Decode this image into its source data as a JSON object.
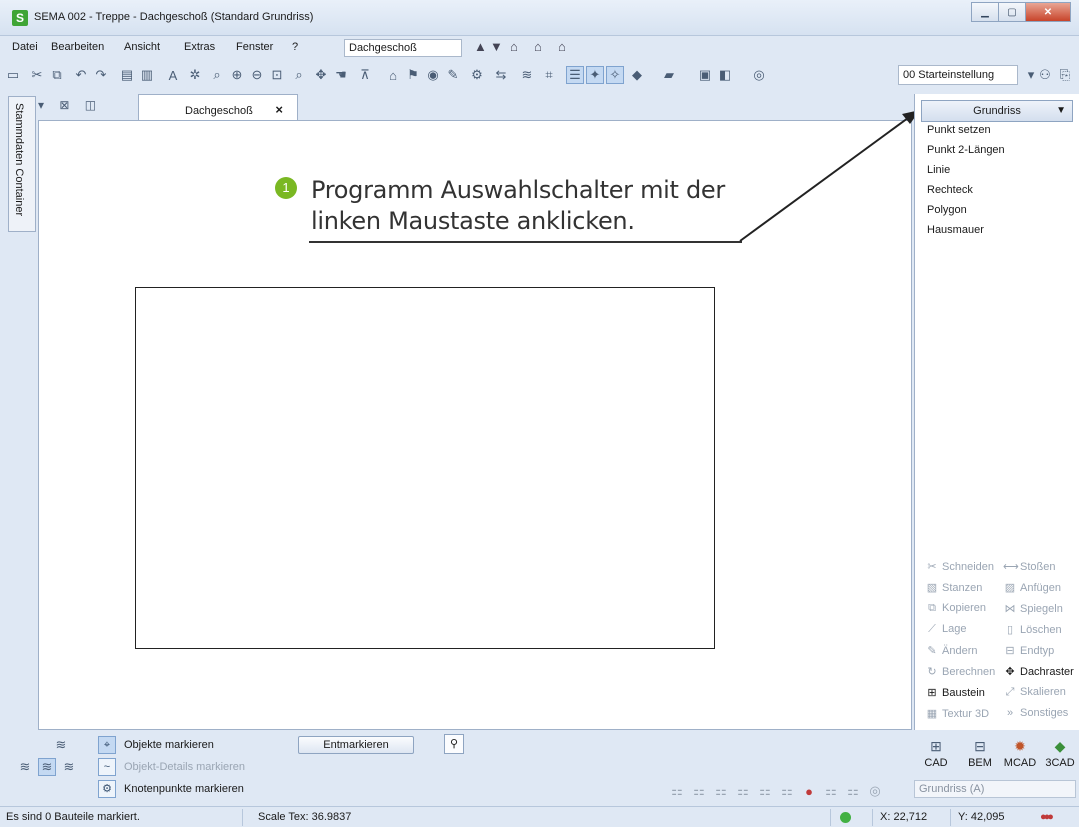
{
  "window": {
    "title": "SEMA  002 - Treppe  - Dachgeschoß (Standard Grundriss)",
    "logo": "S"
  },
  "menu": {
    "items": [
      "Datei",
      "Bearbeiten",
      "Ansicht",
      "Extras",
      "Fenster",
      "?"
    ],
    "floor_select": "Dachgeschoß"
  },
  "toolbar": {
    "layer_select": "00 Starteinstellung"
  },
  "sidebar": {
    "tab_label": "Stammdaten Container"
  },
  "document": {
    "tab_label": "Dachgeschoß",
    "close": "×"
  },
  "callout": {
    "number": "1",
    "line1": "Programm Auswahlschalter mit der",
    "line2": "linken Maustaste anklicken."
  },
  "right_panel": {
    "program_switch": "Grundriss",
    "commands": [
      "Punkt setzen",
      "Punkt 2-Längen",
      "Linie",
      "Rechteck",
      "Polygon",
      "Hausmauer"
    ],
    "edit_buttons": [
      [
        "Schneiden",
        "Stoßen"
      ],
      [
        "Stanzen",
        "Anfügen"
      ],
      [
        "Kopieren",
        "Spiegeln"
      ],
      [
        "Lage",
        "Löschen"
      ],
      [
        "Ändern",
        "Endtyp"
      ],
      [
        "Berechnen",
        "Dachraster"
      ],
      [
        "Baustein",
        "Skalieren"
      ],
      [
        "Textur 3D",
        "Sonstiges"
      ]
    ],
    "modules": [
      "CAD",
      "BEM",
      "MCAD",
      "3CAD"
    ],
    "view_select": "Grundriss (A)"
  },
  "bottom": {
    "objects": "Objekte markieren",
    "details": "Objekt-Details markieren",
    "nodes": "Knotenpunkte markieren",
    "unmark": "Entmarkieren"
  },
  "status": {
    "message": "Es sind 0 Bauteile markiert.",
    "scale": "Scale Tex: 36.9837",
    "x": "X: 22,712",
    "y": "Y: 42,095"
  },
  "colors": {
    "accent_green": "#7ab823",
    "status_green": "#42b043"
  }
}
